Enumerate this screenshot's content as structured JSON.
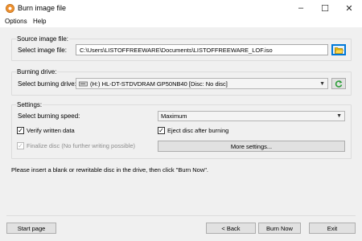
{
  "window": {
    "title": "Burn image file",
    "controls": {
      "minimize": "–",
      "maximize": "☐",
      "close": "✕"
    }
  },
  "menu": [
    "Options",
    "Help"
  ],
  "source": {
    "group_title": "Source image file:",
    "label": "Select image file:",
    "path": "C:\\Users\\LISTOFFREEWARE\\Documents\\LISTOFFREEWARE_LOF.iso",
    "browse_icon": "folder-open-icon"
  },
  "drive": {
    "group_title": "Burning drive:",
    "label": "Select burning drive:",
    "selected": "(H:) HL-DT-STDVDRAM GP50NB40 [Disc: No disc]",
    "refresh_icon": "refresh-icon"
  },
  "settings": {
    "group_title": "Settings:",
    "speed_label": "Select burning speed:",
    "speed_selected": "Maximum",
    "verify_label": "Verify written data",
    "verify_checked": true,
    "eject_label": "Eject disc after burning",
    "eject_checked": true,
    "finalize_label": "Finalize disc (No further writing possible)",
    "finalize_checked": true,
    "more_settings": "More settings..."
  },
  "message": "Please insert a blank or rewritable disc in the drive, then click \"Burn Now\".",
  "footer": {
    "start_page": "Start page",
    "back": "< Back",
    "burn_now": "Burn Now",
    "exit": "Exit"
  },
  "colors": {
    "accent": "#0078d7",
    "folder": "#f2c200",
    "refresh": "#2e9e3a"
  }
}
